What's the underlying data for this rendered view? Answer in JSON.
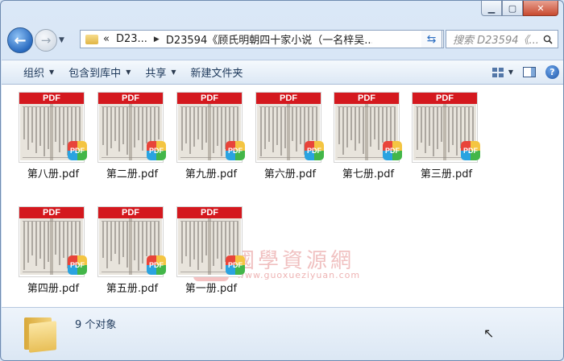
{
  "window": {
    "caption": {
      "minimize": "▁",
      "maximize": "▢",
      "close": "✕"
    }
  },
  "nav": {
    "back_icon": "back-arrow-icon",
    "forward_icon": "forward-arrow-icon",
    "address": {
      "prefix": "«",
      "crumb1": "D23...",
      "crumb2": "D23594《顾氏明朝四十家小说（一名梓吴..."
    },
    "search_placeholder": "搜索 D23594《..."
  },
  "toolbar": {
    "organize": "组织",
    "include_library": "包含到库中",
    "share": "共享",
    "new_folder": "新建文件夹"
  },
  "files": [
    {
      "name": "第八册.pdf",
      "badge": "PDF",
      "thumb_label": "PDF"
    },
    {
      "name": "第二册.pdf",
      "badge": "PDF",
      "thumb_label": "PDF"
    },
    {
      "name": "第九册.pdf",
      "badge": "PDF",
      "thumb_label": "PDF"
    },
    {
      "name": "第六册.pdf",
      "badge": "PDF",
      "thumb_label": "PDF"
    },
    {
      "name": "第七册.pdf",
      "badge": "PDF",
      "thumb_label": "PDF"
    },
    {
      "name": "第三册.pdf",
      "badge": "PDF",
      "thumb_label": "PDF"
    },
    {
      "name": "第四册.pdf",
      "badge": "PDF",
      "thumb_label": "PDF"
    },
    {
      "name": "第五册.pdf",
      "badge": "PDF",
      "thumb_label": "PDF"
    },
    {
      "name": "第一册.pdf",
      "badge": "PDF",
      "thumb_label": "PDF"
    }
  ],
  "watermark": {
    "seal": "國",
    "text": "國學資源網",
    "url": "www.guoxueziyuan.com"
  },
  "status": {
    "count": "9 个对象"
  },
  "colors": {
    "pdf_red": "#d4181e",
    "accent_blue": "#2a6bc0"
  }
}
